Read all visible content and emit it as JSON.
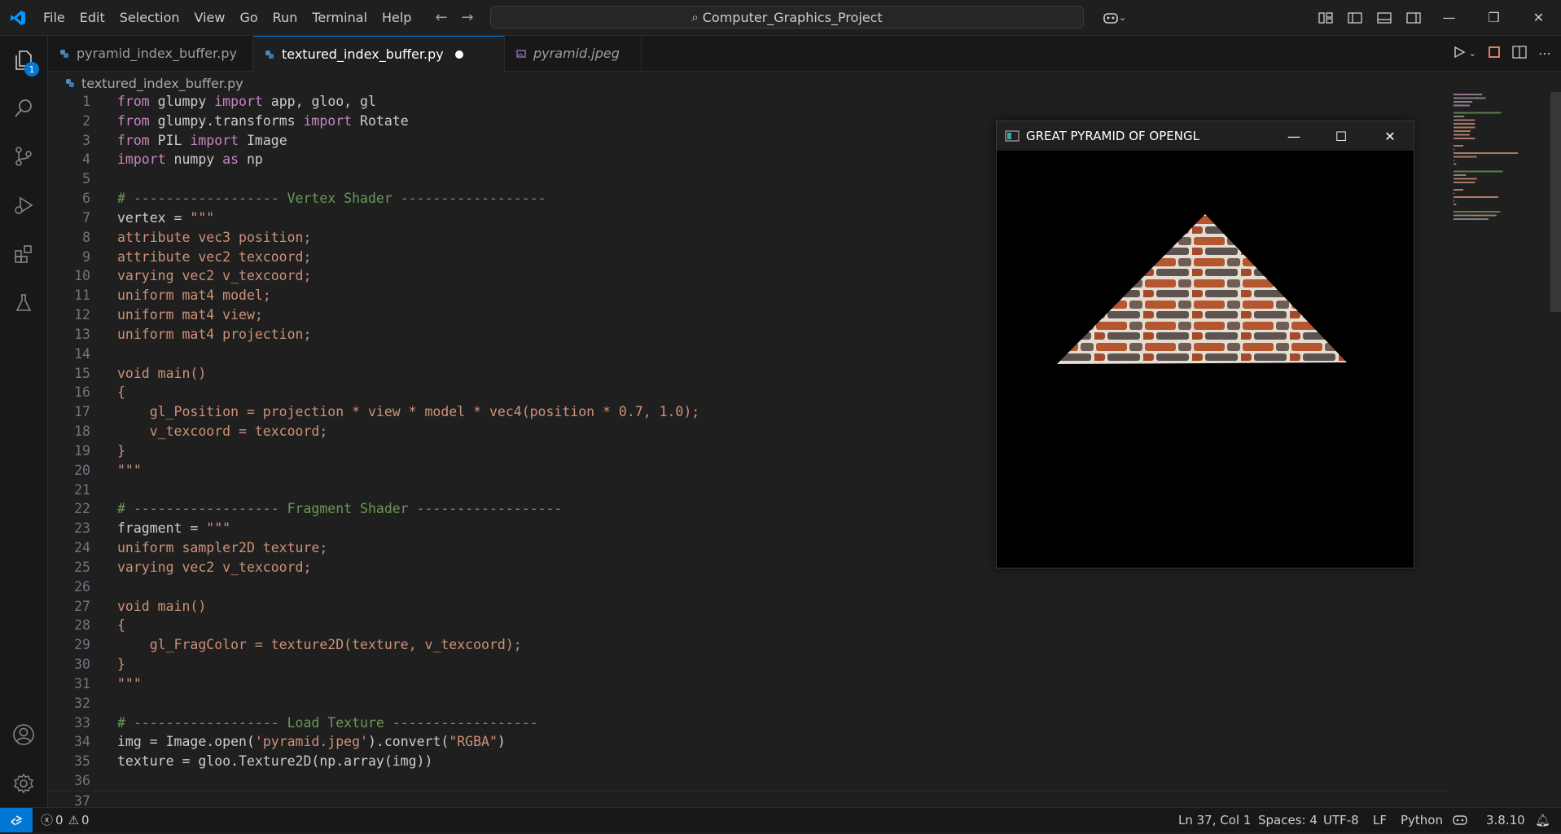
{
  "menu": [
    "File",
    "Edit",
    "Selection",
    "View",
    "Go",
    "Run",
    "Terminal",
    "Help"
  ],
  "search": {
    "text": "Computer_Graphics_Project"
  },
  "activity": {
    "explorer_badge": "1"
  },
  "tabs": [
    {
      "label": "pyramid_index_buffer.py",
      "active": false
    },
    {
      "label": "textured_index_buffer.py",
      "active": true,
      "modified": true
    },
    {
      "label": "pyramid.jpeg",
      "active": false
    }
  ],
  "breadcrumb": "textured_index_buffer.py",
  "code_lines": [
    {
      "n": "1",
      "seg": [
        [
          "k",
          "from"
        ],
        [
          "t",
          " glumpy "
        ],
        [
          "k",
          "import"
        ],
        [
          "t",
          " app, gloo, gl"
        ]
      ]
    },
    {
      "n": "2",
      "seg": [
        [
          "k",
          "from"
        ],
        [
          "t",
          " glumpy.transforms "
        ],
        [
          "k",
          "import"
        ],
        [
          "t",
          " Rotate"
        ]
      ]
    },
    {
      "n": "3",
      "seg": [
        [
          "k",
          "from"
        ],
        [
          "t",
          " PIL "
        ],
        [
          "k",
          "import"
        ],
        [
          "t",
          " Image"
        ]
      ]
    },
    {
      "n": "4",
      "seg": [
        [
          "k",
          "import"
        ],
        [
          "t",
          " numpy "
        ],
        [
          "k",
          "as"
        ],
        [
          "t",
          " np"
        ]
      ]
    },
    {
      "n": "5",
      "seg": []
    },
    {
      "n": "6",
      "seg": [
        [
          "c",
          "# ------------------ Vertex Shader ------------------"
        ]
      ]
    },
    {
      "n": "7",
      "seg": [
        [
          "t",
          "vertex = "
        ],
        [
          "s",
          "\"\"\""
        ]
      ]
    },
    {
      "n": "8",
      "seg": [
        [
          "s",
          "attribute vec3 position;"
        ]
      ]
    },
    {
      "n": "9",
      "seg": [
        [
          "s",
          "attribute vec2 texcoord;"
        ]
      ]
    },
    {
      "n": "10",
      "seg": [
        [
          "s",
          "varying vec2 v_texcoord;"
        ]
      ]
    },
    {
      "n": "11",
      "seg": [
        [
          "s",
          "uniform mat4 model;"
        ]
      ]
    },
    {
      "n": "12",
      "seg": [
        [
          "s",
          "uniform mat4 view;"
        ]
      ]
    },
    {
      "n": "13",
      "seg": [
        [
          "s",
          "uniform mat4 projection;"
        ]
      ]
    },
    {
      "n": "14",
      "seg": []
    },
    {
      "n": "15",
      "seg": [
        [
          "s",
          "void main()"
        ]
      ]
    },
    {
      "n": "16",
      "seg": [
        [
          "s",
          "{"
        ]
      ]
    },
    {
      "n": "17",
      "seg": [
        [
          "s",
          "    gl_Position = projection * view * model * vec4(position * 0.7, 1.0);"
        ]
      ]
    },
    {
      "n": "18",
      "seg": [
        [
          "s",
          "    v_texcoord = texcoord;"
        ]
      ]
    },
    {
      "n": "19",
      "seg": [
        [
          "s",
          "}"
        ]
      ]
    },
    {
      "n": "20",
      "seg": [
        [
          "s",
          "\"\"\""
        ]
      ]
    },
    {
      "n": "21",
      "seg": []
    },
    {
      "n": "22",
      "seg": [
        [
          "c",
          "# ------------------ Fragment Shader ------------------"
        ]
      ]
    },
    {
      "n": "23",
      "seg": [
        [
          "t",
          "fragment = "
        ],
        [
          "s",
          "\"\"\""
        ]
      ]
    },
    {
      "n": "24",
      "seg": [
        [
          "s",
          "uniform sampler2D texture;"
        ]
      ]
    },
    {
      "n": "25",
      "seg": [
        [
          "s",
          "varying vec2 v_texcoord;"
        ]
      ]
    },
    {
      "n": "26",
      "seg": []
    },
    {
      "n": "27",
      "seg": [
        [
          "s",
          "void main()"
        ]
      ]
    },
    {
      "n": "28",
      "seg": [
        [
          "s",
          "{"
        ]
      ]
    },
    {
      "n": "29",
      "seg": [
        [
          "s",
          "    gl_FragColor = texture2D(texture, v_texcoord);"
        ]
      ]
    },
    {
      "n": "30",
      "seg": [
        [
          "s",
          "}"
        ]
      ]
    },
    {
      "n": "31",
      "seg": [
        [
          "s",
          "\"\"\""
        ]
      ]
    },
    {
      "n": "32",
      "seg": []
    },
    {
      "n": "33",
      "seg": [
        [
          "c",
          "# ------------------ Load Texture ------------------"
        ]
      ]
    },
    {
      "n": "34",
      "seg": [
        [
          "t",
          "img = Image.open("
        ],
        [
          "s",
          "'pyramid.jpeg'"
        ],
        [
          "t",
          ").convert("
        ],
        [
          "s",
          "\"RGBA\""
        ],
        [
          "t",
          ")"
        ]
      ]
    },
    {
      "n": "35",
      "seg": [
        [
          "t",
          "texture = gloo.Texture2D(np.array(img))"
        ]
      ]
    },
    {
      "n": "36",
      "seg": []
    },
    {
      "n": "37",
      "seg": []
    }
  ],
  "gl_window": {
    "title": "GREAT PYRAMID OF OPENGL"
  },
  "status": {
    "errors": "0",
    "warnings": "0",
    "position": "Ln 37, Col 1",
    "spaces": "Spaces: 4",
    "encoding": "UTF-8",
    "eol": "LF",
    "language": "Python",
    "version": "3.8.10"
  },
  "colors": {
    "accent": "#0078d4",
    "keyword": "#c586c0",
    "string": "#ce9178",
    "comment": "#6a9955"
  }
}
